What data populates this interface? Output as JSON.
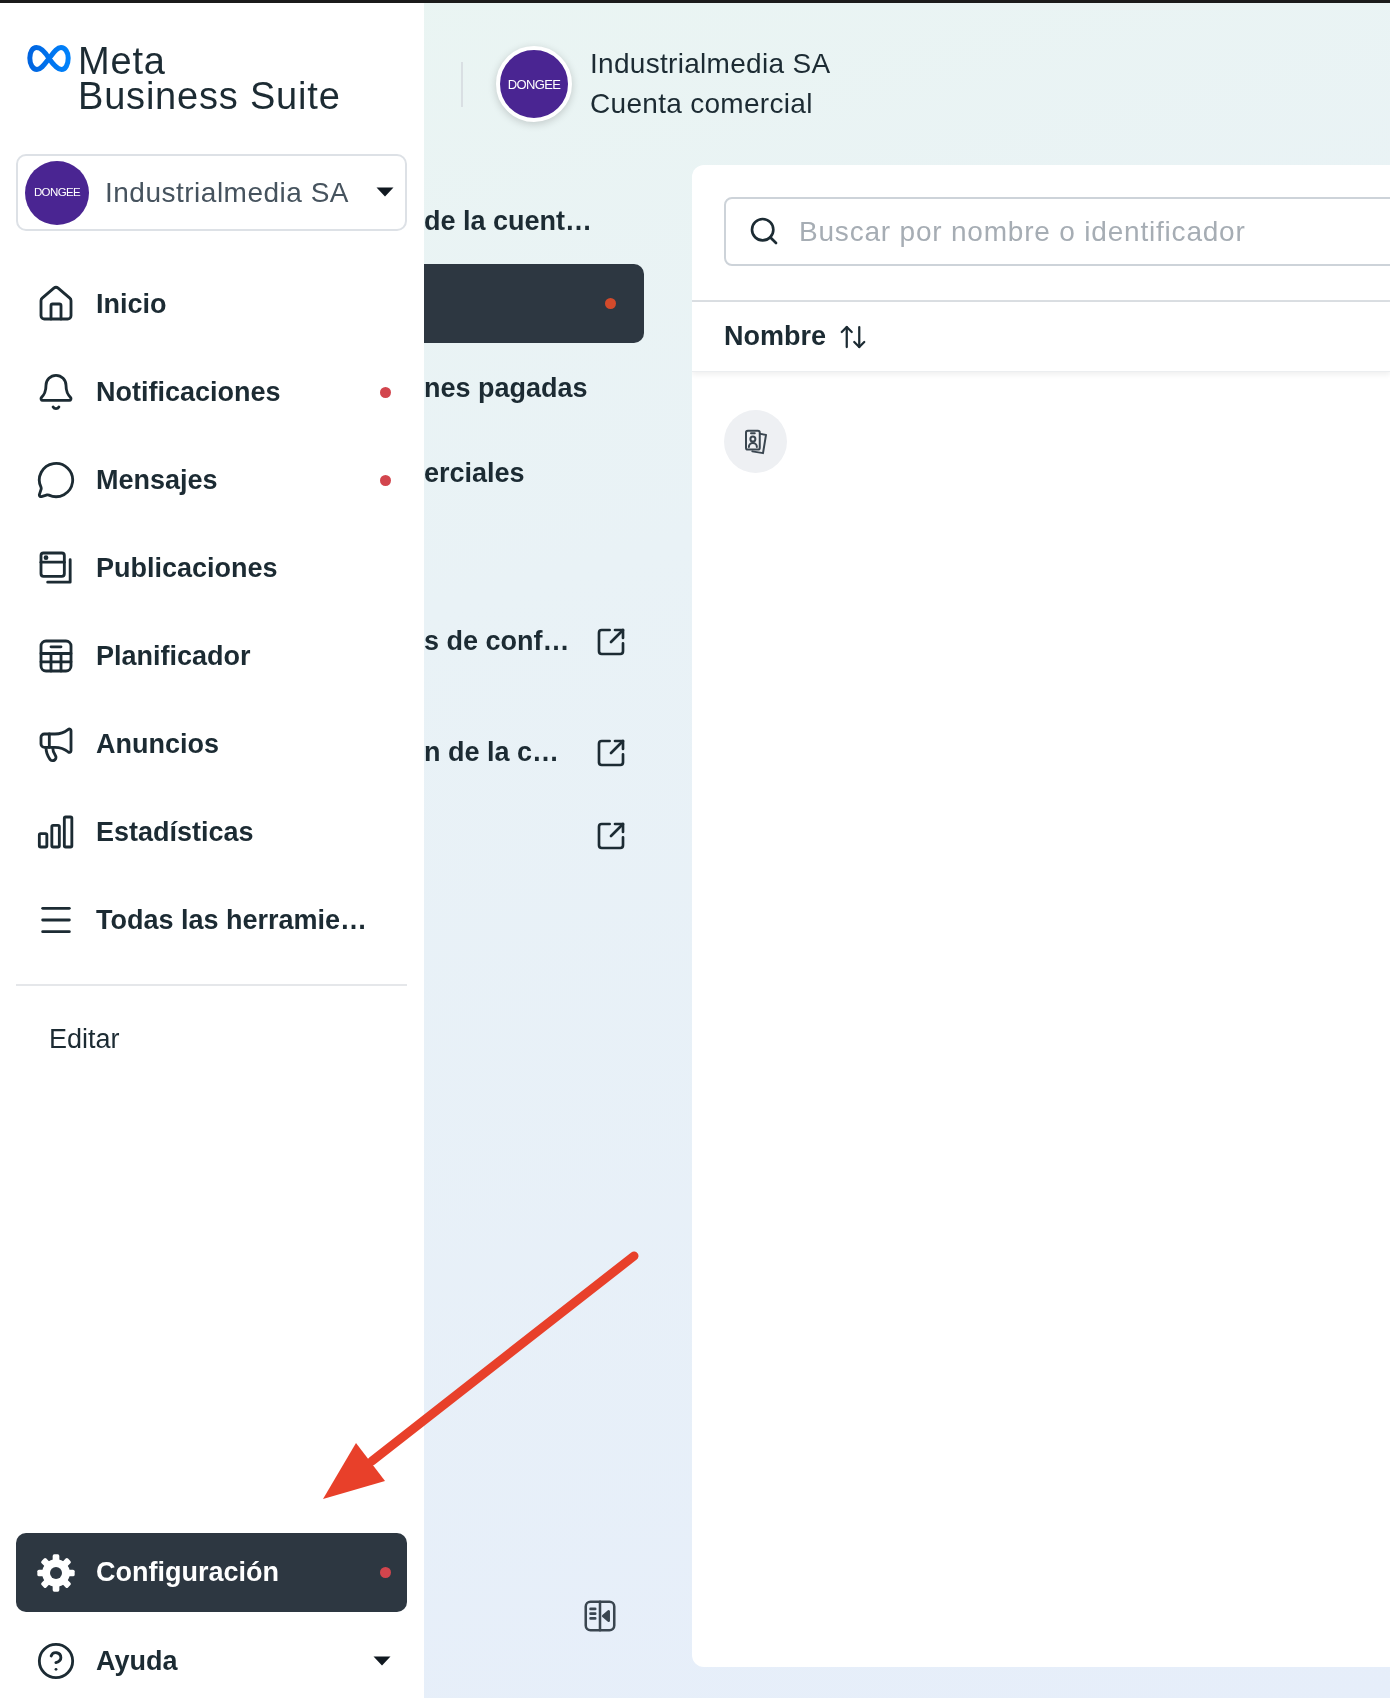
{
  "brand": {
    "wordmark": "Meta",
    "product": "Business Suite"
  },
  "account_switcher": {
    "avatar_text": "DONGEE",
    "name": "Industrialmedia SA"
  },
  "nav": [
    {
      "label": "Inicio",
      "selected": false,
      "badge": false
    },
    {
      "label": "Notificaciones",
      "selected": false,
      "badge": true
    },
    {
      "label": "Mensajes",
      "selected": false,
      "badge": true
    },
    {
      "label": "Publicaciones",
      "selected": false,
      "badge": false
    },
    {
      "label": "Planificador",
      "selected": false,
      "badge": false
    },
    {
      "label": "Anuncios",
      "selected": false,
      "badge": false
    },
    {
      "label": "Estadísticas",
      "selected": false,
      "badge": false
    },
    {
      "label": "Todas las herramie…",
      "selected": false,
      "badge": false
    }
  ],
  "edit_link": "Editar",
  "footer_nav": [
    {
      "kind": "link",
      "label": "Configuración",
      "selected": true,
      "badge": true
    },
    {
      "kind": "menu",
      "label": "Ayuda",
      "selected": false,
      "badge": false
    }
  ],
  "account_nav": {
    "heading": "de la cuent…",
    "items": [
      {
        "selected": true,
        "badge": true
      },
      {
        "label": "nes pagadas",
        "selected": false,
        "badge": false
      },
      {
        "label": "erciales",
        "selected": false,
        "badge": false
      }
    ],
    "links": [
      {
        "label": "s de conf…",
        "external": true
      },
      {
        "label": "n de la c…",
        "external": true
      },
      {
        "external": true
      }
    ]
  },
  "header": {
    "avatar_text": "DONGEE",
    "title": "Industrialmedia SA",
    "subtitle": "Cuenta comercial"
  },
  "search": {
    "placeholder": "Buscar por nombre o identificador"
  },
  "table": {
    "columns": [
      {
        "label": "Nombre",
        "sortable": true
      }
    ],
    "rows": [
      {
        "kind": "profile"
      }
    ]
  },
  "annotations": [
    {
      "kind": "arrow"
    }
  ]
}
